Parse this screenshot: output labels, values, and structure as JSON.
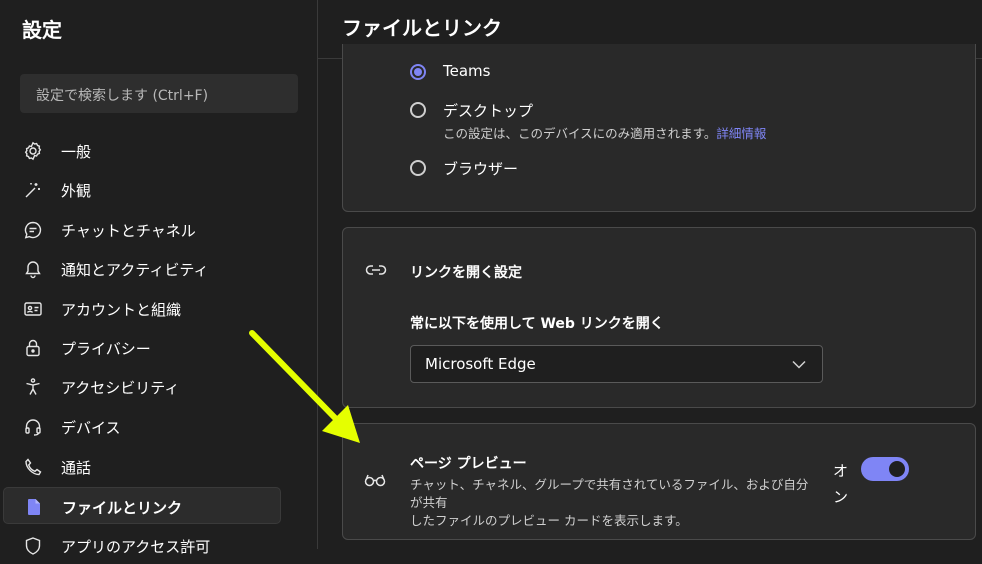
{
  "sidebar": {
    "title": "設定",
    "search_placeholder": "設定で検索します (Ctrl+F)",
    "items": [
      {
        "label": "一般",
        "icon": "gear-icon"
      },
      {
        "label": "外観",
        "icon": "magic-wand-icon"
      },
      {
        "label": "チャットとチャネル",
        "icon": "chat-bubble-icon"
      },
      {
        "label": "通知とアクティビティ",
        "icon": "bell-icon"
      },
      {
        "label": "アカウントと組織",
        "icon": "id-card-icon"
      },
      {
        "label": "プライバシー",
        "icon": "lock-icon"
      },
      {
        "label": "アクセシビリティ",
        "icon": "accessibility-icon"
      },
      {
        "label": "デバイス",
        "icon": "headset-icon"
      },
      {
        "label": "通話",
        "icon": "phone-icon"
      },
      {
        "label": "ファイルとリンク",
        "icon": "file-icon",
        "selected": true
      },
      {
        "label": "アプリのアクセス許可",
        "icon": "shield-icon"
      }
    ]
  },
  "main": {
    "title": "ファイルとリンク",
    "open_files": {
      "options": [
        {
          "label": "Teams",
          "checked": true
        },
        {
          "label": "デスクトップ",
          "checked": false,
          "sub": "この設定は、このデバイスにのみ適用されます。",
          "link": "詳細情報"
        },
        {
          "label": "ブラウザー",
          "checked": false
        }
      ]
    },
    "link_settings": {
      "title": "リンクを開く設定",
      "icon": "link-icon",
      "prompt": "常に以下を使用して Web リンクを開く",
      "selected_browser": "Microsoft Edge"
    },
    "page_preview": {
      "title": "ページ プレビュー",
      "icon": "glasses-icon",
      "description_line1": "チャット、チャネル、グループで共有されているファイル、および自分が共有",
      "description_line2": "したファイルのプレビュー カードを表示します。",
      "toggle_label_line1": "オ",
      "toggle_label_line2": "ン",
      "toggle_on": true
    }
  },
  "colors": {
    "accent": "#7f85f5",
    "annotation_arrow": "#e5ff00"
  }
}
